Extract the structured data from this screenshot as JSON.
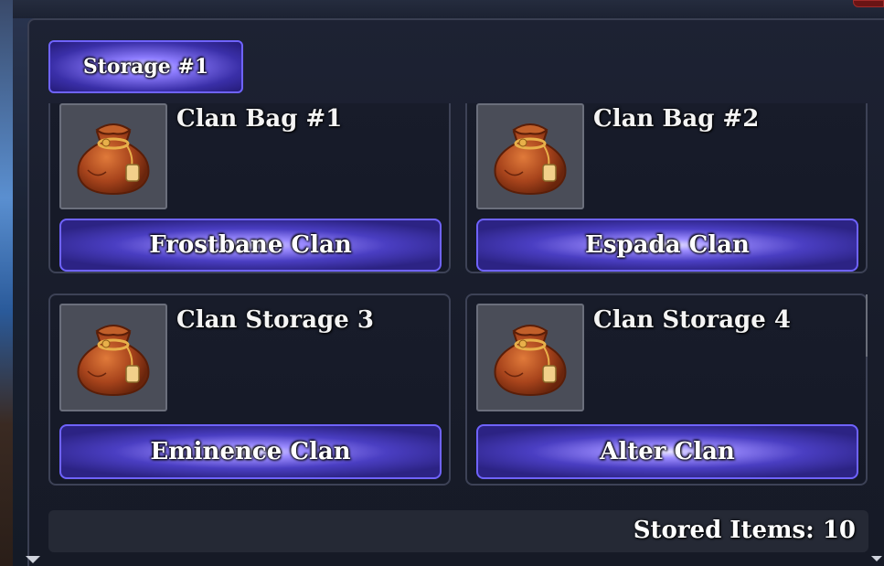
{
  "storage_tab": {
    "label": "Storage #1"
  },
  "cards": [
    {
      "title": "Clan Bag #1",
      "clan_button": "Frostbane Clan",
      "icon": "leather-bag-icon"
    },
    {
      "title": "Clan Bag #2",
      "clan_button": "Espada Clan",
      "icon": "leather-bag-icon"
    },
    {
      "title": "Clan Storage 3",
      "clan_button": "Eminence Clan",
      "icon": "leather-bag-icon"
    },
    {
      "title": "Clan Storage 4",
      "clan_button": "Alter Clan",
      "icon": "leather-bag-icon"
    }
  ],
  "footer": {
    "stored_items": "Stored Items: 10"
  },
  "colors": {
    "accent": "#6f63ff",
    "panel": "#181c2a",
    "slot": "#4a4d58"
  }
}
